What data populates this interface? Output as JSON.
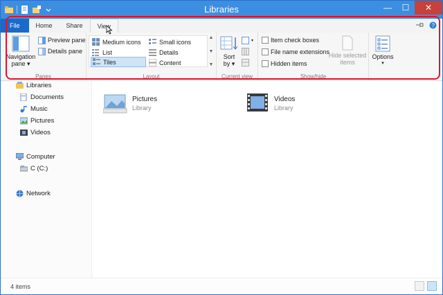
{
  "window": {
    "title": "Libraries"
  },
  "tabs": {
    "file": "File",
    "home": "Home",
    "share": "Share",
    "view": "View"
  },
  "ribbon": {
    "panes": {
      "label": "Panes",
      "navigation_pane_line1": "Navigation",
      "navigation_pane_line2": "pane",
      "preview_pane": "Preview pane",
      "details_pane": "Details pane"
    },
    "layout": {
      "label": "Layout",
      "items": [
        "Medium icons",
        "Small icons",
        "List",
        "Details",
        "Tiles",
        "Content"
      ],
      "selected": "Tiles"
    },
    "current_view": {
      "label": "Current view",
      "sort_by_line1": "Sort",
      "sort_by_line2": "by"
    },
    "show_hide": {
      "label": "Show/hide",
      "item_check_boxes": "Item check boxes",
      "file_name_extensions": "File name extensions",
      "hidden_items": "Hidden items",
      "hide_selected_line1": "Hide selected",
      "hide_selected_line2": "items"
    },
    "options": {
      "label": "Options"
    }
  },
  "sidebar": {
    "libraries": "Libraries",
    "documents": "Documents",
    "music": "Music",
    "pictures": "Pictures",
    "videos": "Videos",
    "computer": "Computer",
    "drive_c": "C (C:)",
    "network": "Network"
  },
  "content": {
    "tiles": [
      {
        "name": "Pictures",
        "type": "Library"
      },
      {
        "name": "Videos",
        "type": "Library"
      }
    ]
  },
  "status": {
    "item_count": "4 items"
  },
  "colors": {
    "titlebar": "#3c8fe0",
    "file_tab": "#1b6ac9",
    "highlight_outline": "#e0132b",
    "selected": "#cfe4f7"
  }
}
